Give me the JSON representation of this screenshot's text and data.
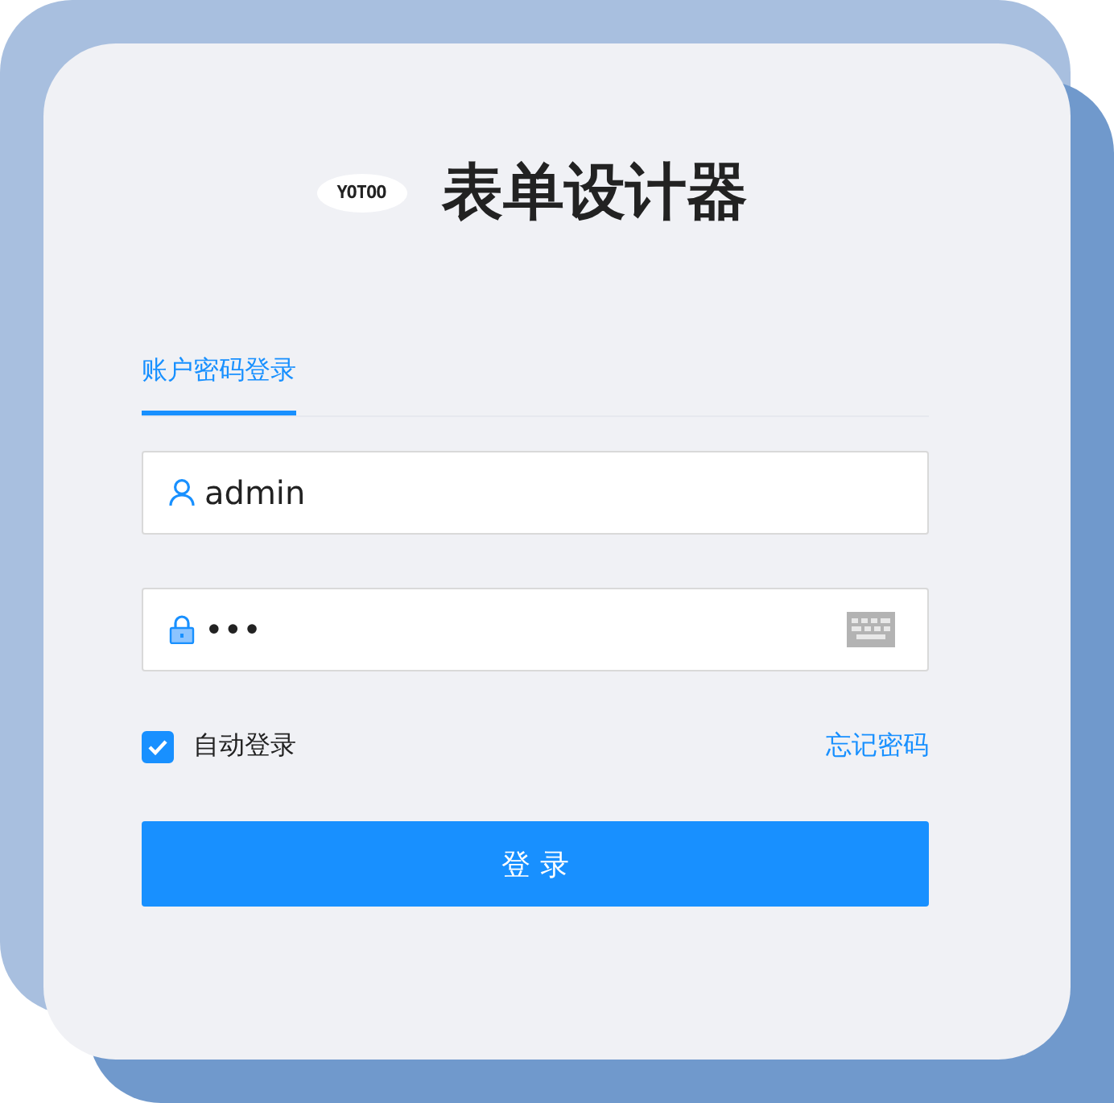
{
  "logo": {
    "text": "YOTOO"
  },
  "title": "表单设计器",
  "tabs": [
    {
      "label": "账户密码登录",
      "selected": true
    }
  ],
  "username": {
    "value": "admin"
  },
  "password": {
    "value": "•••"
  },
  "auto_login": {
    "label": "自动登录",
    "checked": true
  },
  "forgot_link": "忘记密码",
  "login_button": "登 录"
}
